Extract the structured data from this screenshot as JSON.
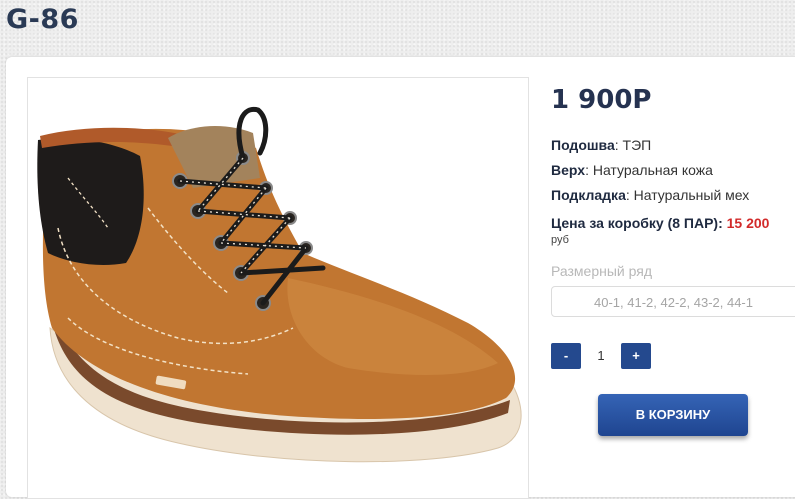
{
  "product": {
    "title": "G-86",
    "price": "1 900Р"
  },
  "specs": [
    {
      "label": "Подошва",
      "value": "ТЭП"
    },
    {
      "label": "Верх",
      "value": "Натуральная кожа"
    },
    {
      "label": "Подкладка",
      "value": "Натуральный мех"
    }
  ],
  "box_price": {
    "label": "Цена за коробку (8 ПАР):",
    "value": "15 200",
    "currency": "руб"
  },
  "sizes": {
    "label": "Размерный ряд",
    "selected": "40-1, 41-2, 42-2, 43-2, 44-1"
  },
  "quantity": {
    "minus": "-",
    "value": "1",
    "plus": "+"
  },
  "cart_button": "В КОРЗИНУ",
  "colors": {
    "accent": "#24498e",
    "price_red": "#d22a2a",
    "title": "#2a3a55"
  }
}
